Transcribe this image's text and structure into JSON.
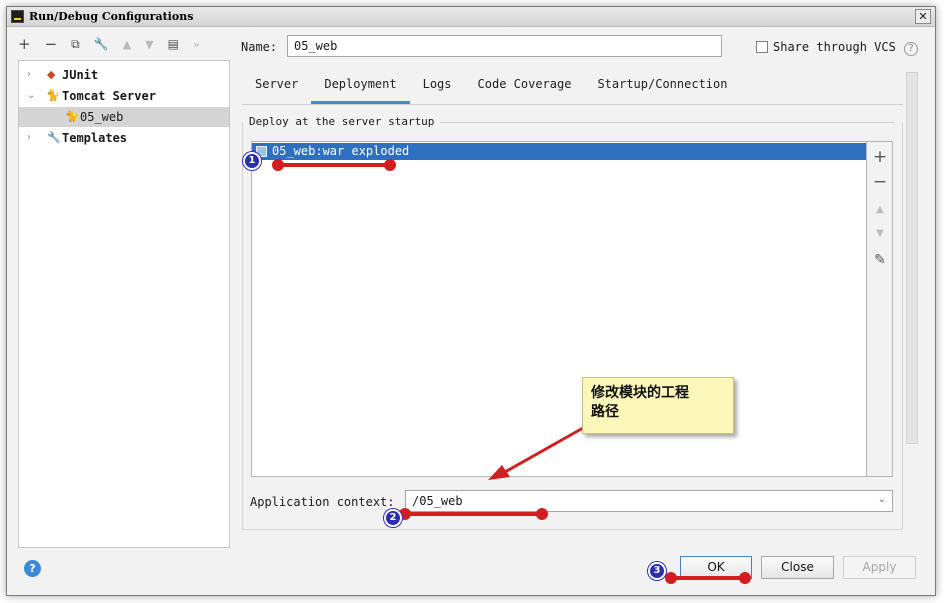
{
  "window": {
    "title": "Run/Debug Configurations",
    "close_glyph": "✕"
  },
  "toolbar": {
    "items": [
      {
        "name": "add-config",
        "glyph": "+"
      },
      {
        "name": "remove-config",
        "glyph": "−"
      },
      {
        "name": "copy-config",
        "glyph": "⧉"
      },
      {
        "name": "edit-defaults",
        "glyph": "🔧"
      },
      {
        "name": "move-up",
        "glyph": "▲"
      },
      {
        "name": "move-down",
        "glyph": "▼"
      },
      {
        "name": "new-folder",
        "glyph": "▤"
      },
      {
        "name": "more",
        "glyph": "»"
      }
    ]
  },
  "tree": {
    "items": [
      {
        "label": "JUnit",
        "icon": "junit-icon",
        "glyph": "◆",
        "expander": "›",
        "color": "#c84a2c"
      },
      {
        "label": "Tomcat Server",
        "icon": "tomcat-icon",
        "glyph": "🐈",
        "expander": "⌄",
        "color": "#c87a20"
      },
      {
        "label": "05_web",
        "icon": "tomcat-icon",
        "glyph": "🐈",
        "selected": true,
        "color": "#c87a20"
      },
      {
        "label": "Templates",
        "icon": "wrench-icon",
        "glyph": "🔧",
        "expander": "›",
        "color": "#666666"
      }
    ]
  },
  "config": {
    "name_label": "Name:",
    "name_value": "05_web",
    "share_label": "Share through VCS",
    "share_checked": false,
    "help_glyph": "?"
  },
  "tabs": [
    {
      "label": "Server",
      "active": false
    },
    {
      "label": "Deployment",
      "active": true
    },
    {
      "label": "Logs",
      "active": false
    },
    {
      "label": "Code Coverage",
      "active": false
    },
    {
      "label": "Startup/Connection",
      "active": false
    }
  ],
  "deployment": {
    "section_title": "Deploy at the server startup",
    "artifacts": [
      "05_web:war exploded"
    ],
    "side_tools": [
      {
        "name": "add-artifact",
        "glyph": "+"
      },
      {
        "name": "remove-artifact",
        "glyph": "−"
      },
      {
        "name": "move-artifact-up",
        "glyph": "▲"
      },
      {
        "name": "move-artifact-down",
        "glyph": "▼"
      },
      {
        "name": "edit-artifact",
        "glyph": "✎"
      }
    ],
    "context_label": "Application context:",
    "context_value": "/05_web",
    "context_chevron": "⌄"
  },
  "buttons": {
    "ok": "OK",
    "close": "Close",
    "apply": "Apply",
    "help": "?"
  },
  "annotations": {
    "badges": [
      "1",
      "2",
      "3"
    ],
    "note_line1": "修改模块的工程",
    "note_line2": "路径",
    "arrow_color": "#d11f1f",
    "badge_color": "#2b2fae"
  },
  "colors": {
    "selection": "#2f6fbf",
    "tab_underline": "#4a88c7",
    "note_bg": "#fbf7b8"
  }
}
